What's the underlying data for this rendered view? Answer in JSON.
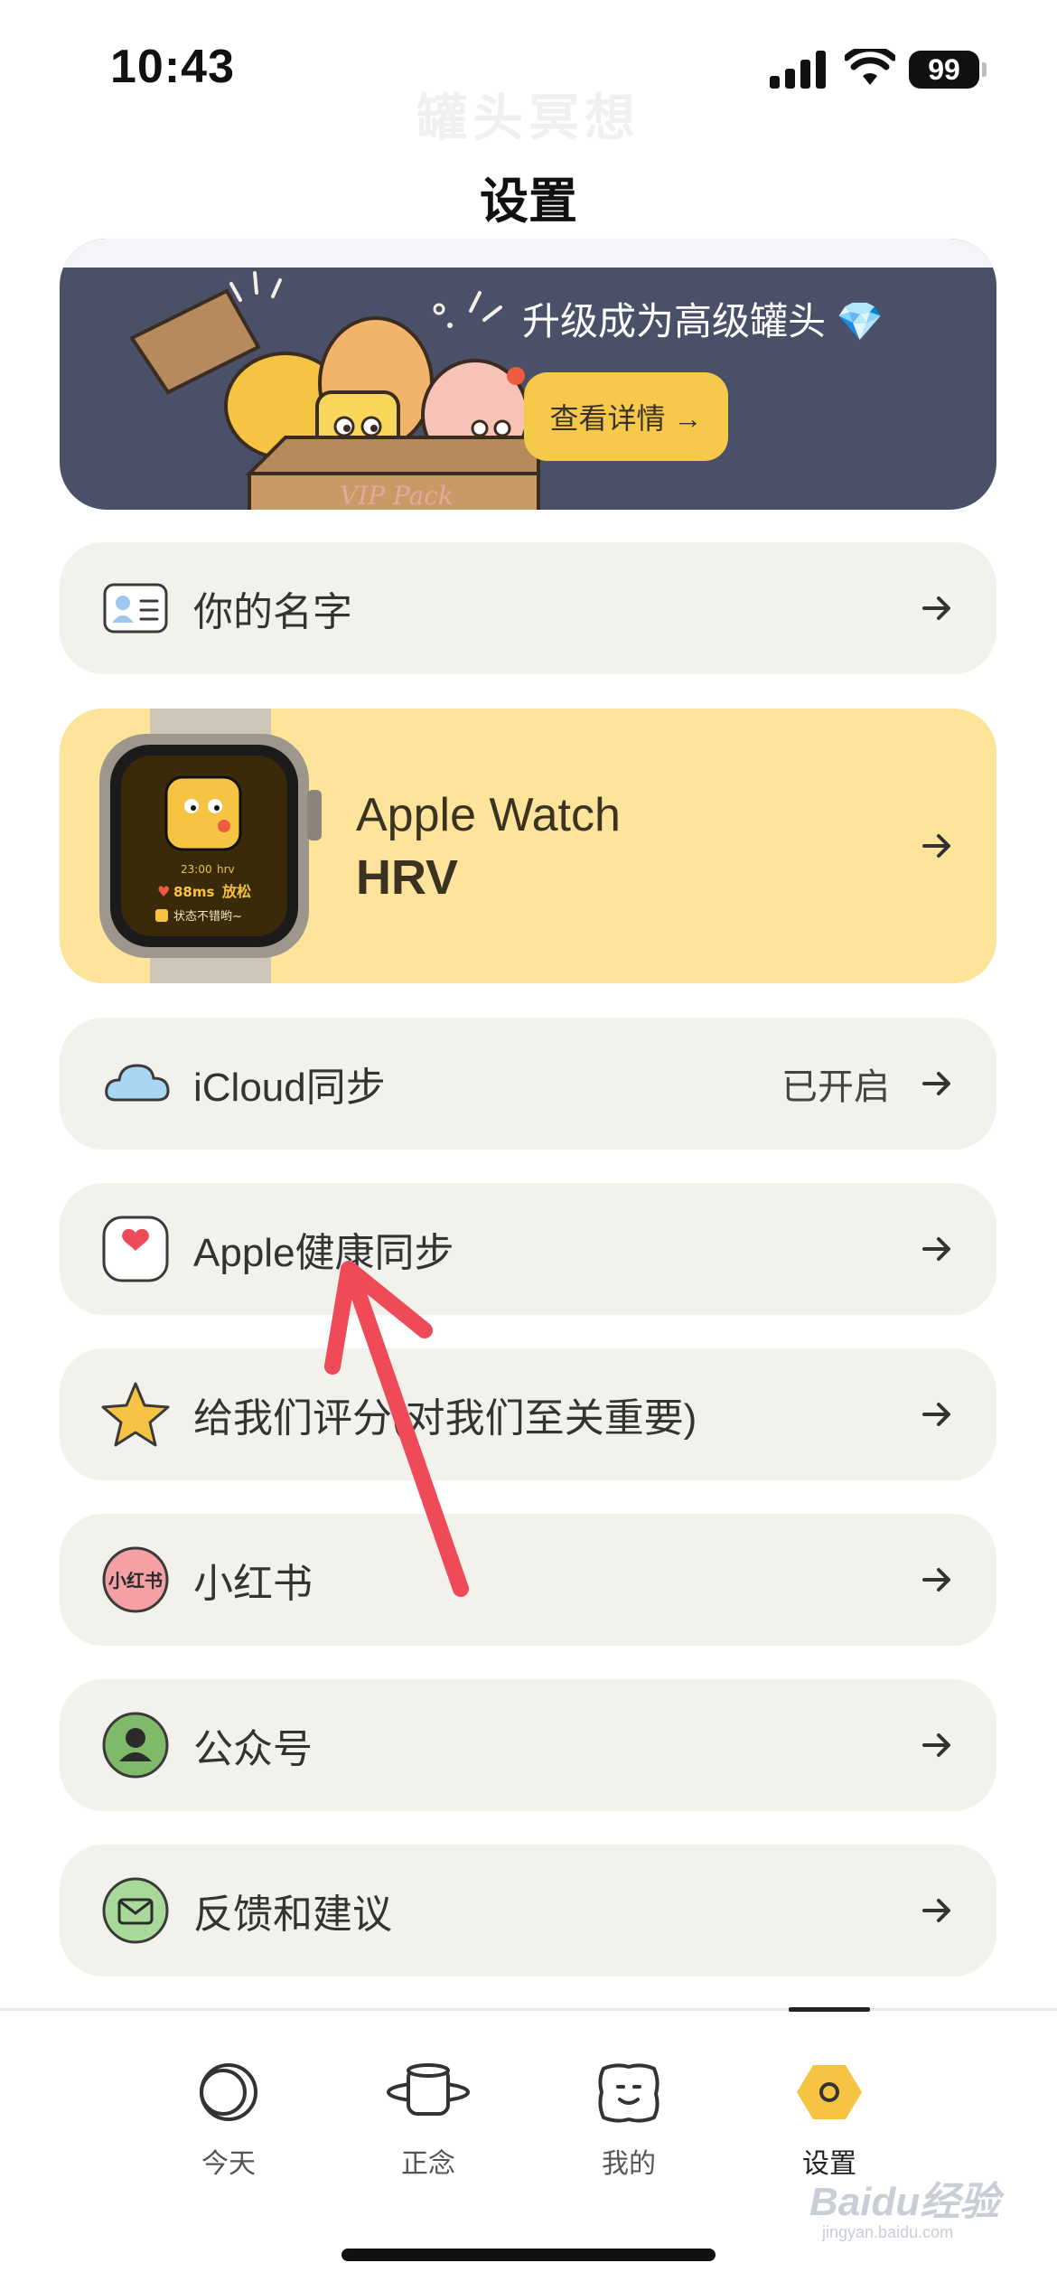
{
  "status_bar": {
    "time": "10:43",
    "battery": "99"
  },
  "header": {
    "faded_title": "罐头冥想",
    "title": "设置"
  },
  "banner": {
    "headline": "升级成为高级罐头 💎",
    "button_label": "查看详情 →",
    "box_text": "VIP Pack"
  },
  "rows": [
    {
      "label": "你的名字",
      "icon": "id-card-icon"
    },
    {
      "icon": "apple-watch-image"
    },
    {
      "label": "iCloud同步",
      "status": "已开启",
      "icon": "cloud-icon"
    },
    {
      "label": "Apple健康同步",
      "icon": "heart-icon"
    },
    {
      "label": "给我们评分(对我们至关重要)",
      "icon": "star-icon"
    },
    {
      "label": "小红书",
      "icon": "xiaohongshu-icon"
    },
    {
      "label": "公众号",
      "icon": "person-icon"
    },
    {
      "label": "反馈和建议",
      "icon": "mail-icon"
    }
  ],
  "watch": {
    "title": "Apple Watch",
    "subtitle": "HRV",
    "screen": {
      "time": "23:00",
      "metric": "hrv",
      "value": "88ms",
      "mood": "放松",
      "message": "状态不错哟~"
    }
  },
  "tabs": [
    {
      "label": "今天"
    },
    {
      "label": "正念"
    },
    {
      "label": "我的"
    },
    {
      "label": "设置"
    }
  ],
  "watermark": {
    "brand": "Baidu经验",
    "url": "jingyan.baidu.com"
  },
  "colors": {
    "banner_bg": "#4a5068",
    "accent_yellow": "#f7c94a",
    "row_bg": "#f3f1ec",
    "watch_row_bg": "#fde49a",
    "annotation_red": "#ee4a57"
  }
}
